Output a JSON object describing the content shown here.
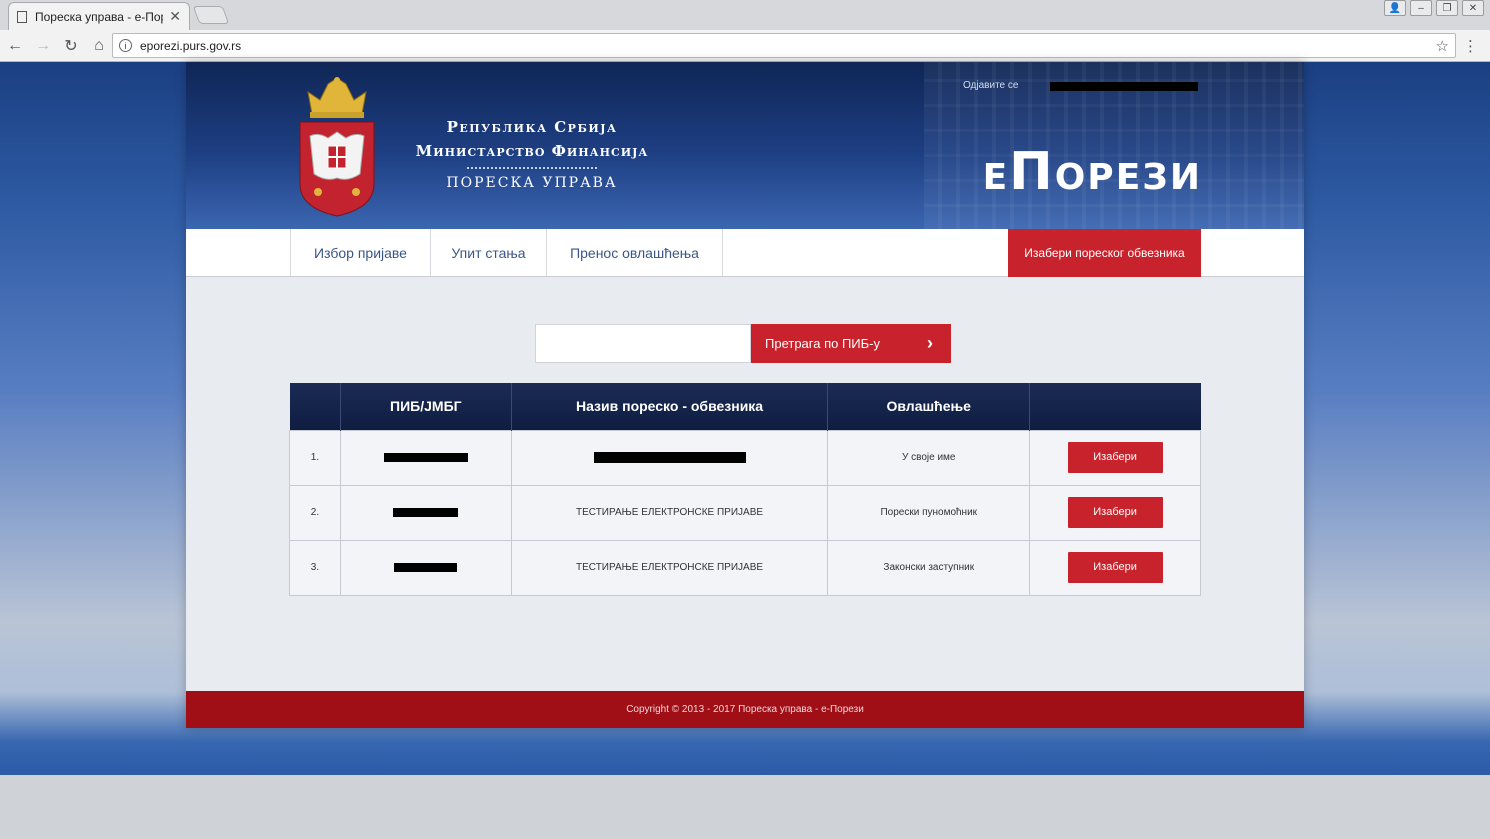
{
  "browser": {
    "tab_title": "Пореска управа - е-Пор",
    "url": "eporezi.purs.gov.rs"
  },
  "header": {
    "org_line1": "Република Србија",
    "org_line2": "Министарство Финансија",
    "org_line3": "ПОРЕСКА УПРАВА",
    "brand": "еПорези",
    "logout": "Одјавите се"
  },
  "nav": {
    "items": [
      "Избор пријаве",
      "Упит стања",
      "Пренос овлашћења"
    ],
    "cta": "Изабери пореског обвезника"
  },
  "search": {
    "button_label": "Претрага по ПИБ-у"
  },
  "table": {
    "headers": [
      "",
      "ПИБ/ЈМБГ",
      "Назив пореско - обвезника",
      "Овлашћење",
      ""
    ],
    "rows": [
      {
        "num": "1.",
        "name": "",
        "authority": "У своје име",
        "action": "Изабери"
      },
      {
        "num": "2.",
        "name": "ТЕСТИРАЊЕ ЕЛЕКТРОНСКЕ ПРИЈАВЕ",
        "authority": "Порески пуномоћник",
        "action": "Изабери"
      },
      {
        "num": "3.",
        "name": "ТЕСТИРАЊЕ ЕЛЕКТРОНСКЕ ПРИЈАВЕ",
        "authority": "Законски заступник",
        "action": "Изабери"
      }
    ]
  },
  "footer": {
    "copyright": "Copyright © 2013 - 2017 Пореска управа - е-Порези"
  },
  "colors": {
    "accent_red": "#c8232c",
    "header_blue": "#1e3f83",
    "footer_red": "#a00e16"
  }
}
